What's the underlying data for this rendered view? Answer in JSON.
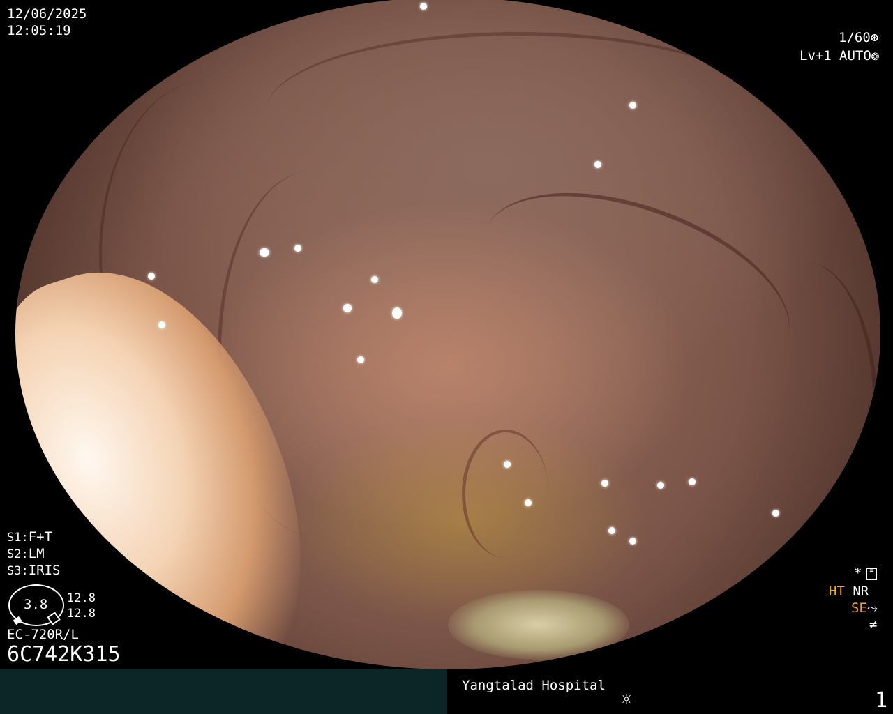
{
  "overlay": {
    "date": "12/06/2025",
    "time": "12:05:19",
    "shutter": "1/60",
    "level": "Lv+1",
    "iris_mode": "AUTO",
    "settings": [
      {
        "key": "S1:",
        "value": "F+T"
      },
      {
        "key": "S2:",
        "value": "LM"
      },
      {
        "key": "S3:",
        "value": "IRIS"
      }
    ],
    "gauge_value": "3.8",
    "gauge_side_values": [
      "12.8",
      "12.8"
    ],
    "scope_model": "EC-720R/L",
    "serial": "6C742K315",
    "mode_star": "*",
    "mode_ht": "HT",
    "mode_nr": "NR",
    "mode_se": "SE",
    "icons": {
      "shutter": "aperture-icon",
      "auto": "iris-icon",
      "settings": "settings-icon",
      "se": "structure-enhance-icon",
      "freeze": "freeze-icon",
      "brightness": "sun-icon"
    },
    "colors": {
      "accent": "#f5a623",
      "bar": "#0c2628"
    }
  },
  "footer": {
    "hospital": "Yangtalad Hospital",
    "page": "1"
  }
}
